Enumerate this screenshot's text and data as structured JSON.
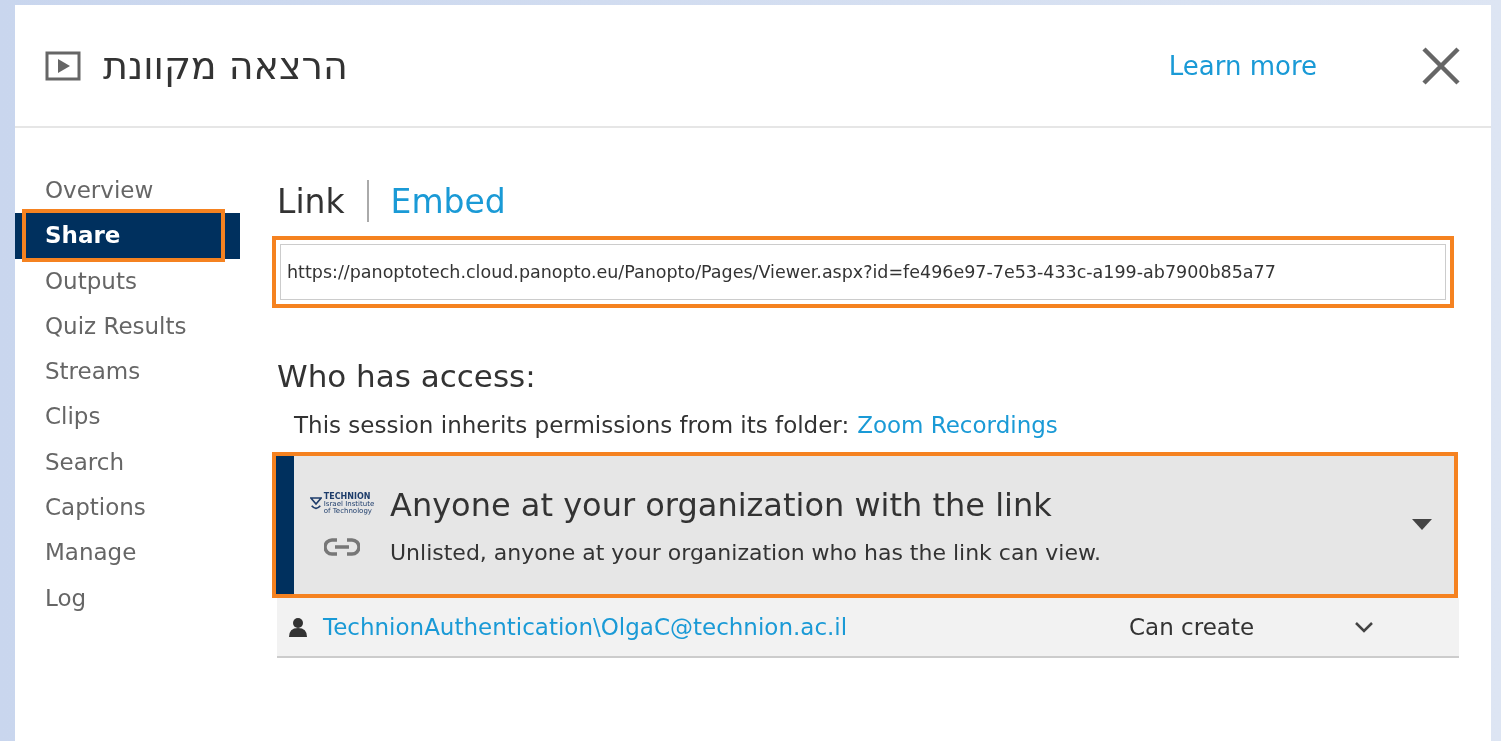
{
  "dialog": {
    "title": "הרצאה מקוונת",
    "learn_more": "Learn more"
  },
  "sidebar": {
    "items": [
      {
        "label": "Overview",
        "selected": false,
        "highlighted": false
      },
      {
        "label": "Share",
        "selected": true,
        "highlighted": true
      },
      {
        "label": "Outputs",
        "selected": false,
        "highlighted": false
      },
      {
        "label": "Quiz Results",
        "selected": false,
        "highlighted": false
      },
      {
        "label": "Streams",
        "selected": false,
        "highlighted": false
      },
      {
        "label": "Clips",
        "selected": false,
        "highlighted": false
      },
      {
        "label": "Search",
        "selected": false,
        "highlighted": false
      },
      {
        "label": "Captions",
        "selected": false,
        "highlighted": false
      },
      {
        "label": "Manage",
        "selected": false,
        "highlighted": false
      },
      {
        "label": "Log",
        "selected": false,
        "highlighted": false
      }
    ]
  },
  "share_tabs": [
    {
      "label": "Link",
      "selected": true
    },
    {
      "label": "Embed",
      "selected": false
    }
  ],
  "link_field": {
    "value": "https://panoptotech.cloud.panopto.eu/Panopto/Pages/Viewer.aspx?id=fe496e97-7e53-433c-a199-ab7900b85a77",
    "highlighted": true
  },
  "access": {
    "heading": "Who has access:",
    "inherit_text": "This session inherits permissions from its folder:",
    "folder_link": "Zoom Recordings",
    "option": {
      "logo_lines": [
        "TECHNION",
        "Israel Institute",
        "of Technology"
      ],
      "title": "Anyone at your organization with the link",
      "description": "Unlisted, anyone at your organization who has the link can view.",
      "highlighted": true
    },
    "users": [
      {
        "name": "TechnionAuthentication\\OlgaC@technion.ac.il",
        "role": "Can create"
      }
    ]
  }
}
